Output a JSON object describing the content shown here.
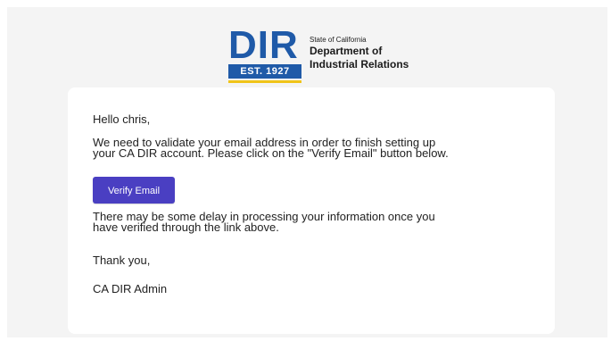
{
  "logo": {
    "letters": "DIR",
    "est": "EST. 1927",
    "state": "State of California",
    "dept_line1": "Department of",
    "dept_line2": "Industrial Relations"
  },
  "email": {
    "greeting": "Hello chris,",
    "body1_line1": "We need to validate your email address in order to finish setting up",
    "body1_line2": "your CA DIR account. Please click on the \"Verify Email\" button below.",
    "verify_button": "Verify Email",
    "body2_line1": "There may be some delay in processing your information once you",
    "body2_line2": "have verified through the link above.",
    "thanks": "Thank you,",
    "signature": "CA DIR Admin"
  },
  "colors": {
    "brand_blue": "#1f5aa8",
    "brand_gold": "#f0c419",
    "button": "#4a3fc2",
    "background": "#f4f4f4"
  }
}
